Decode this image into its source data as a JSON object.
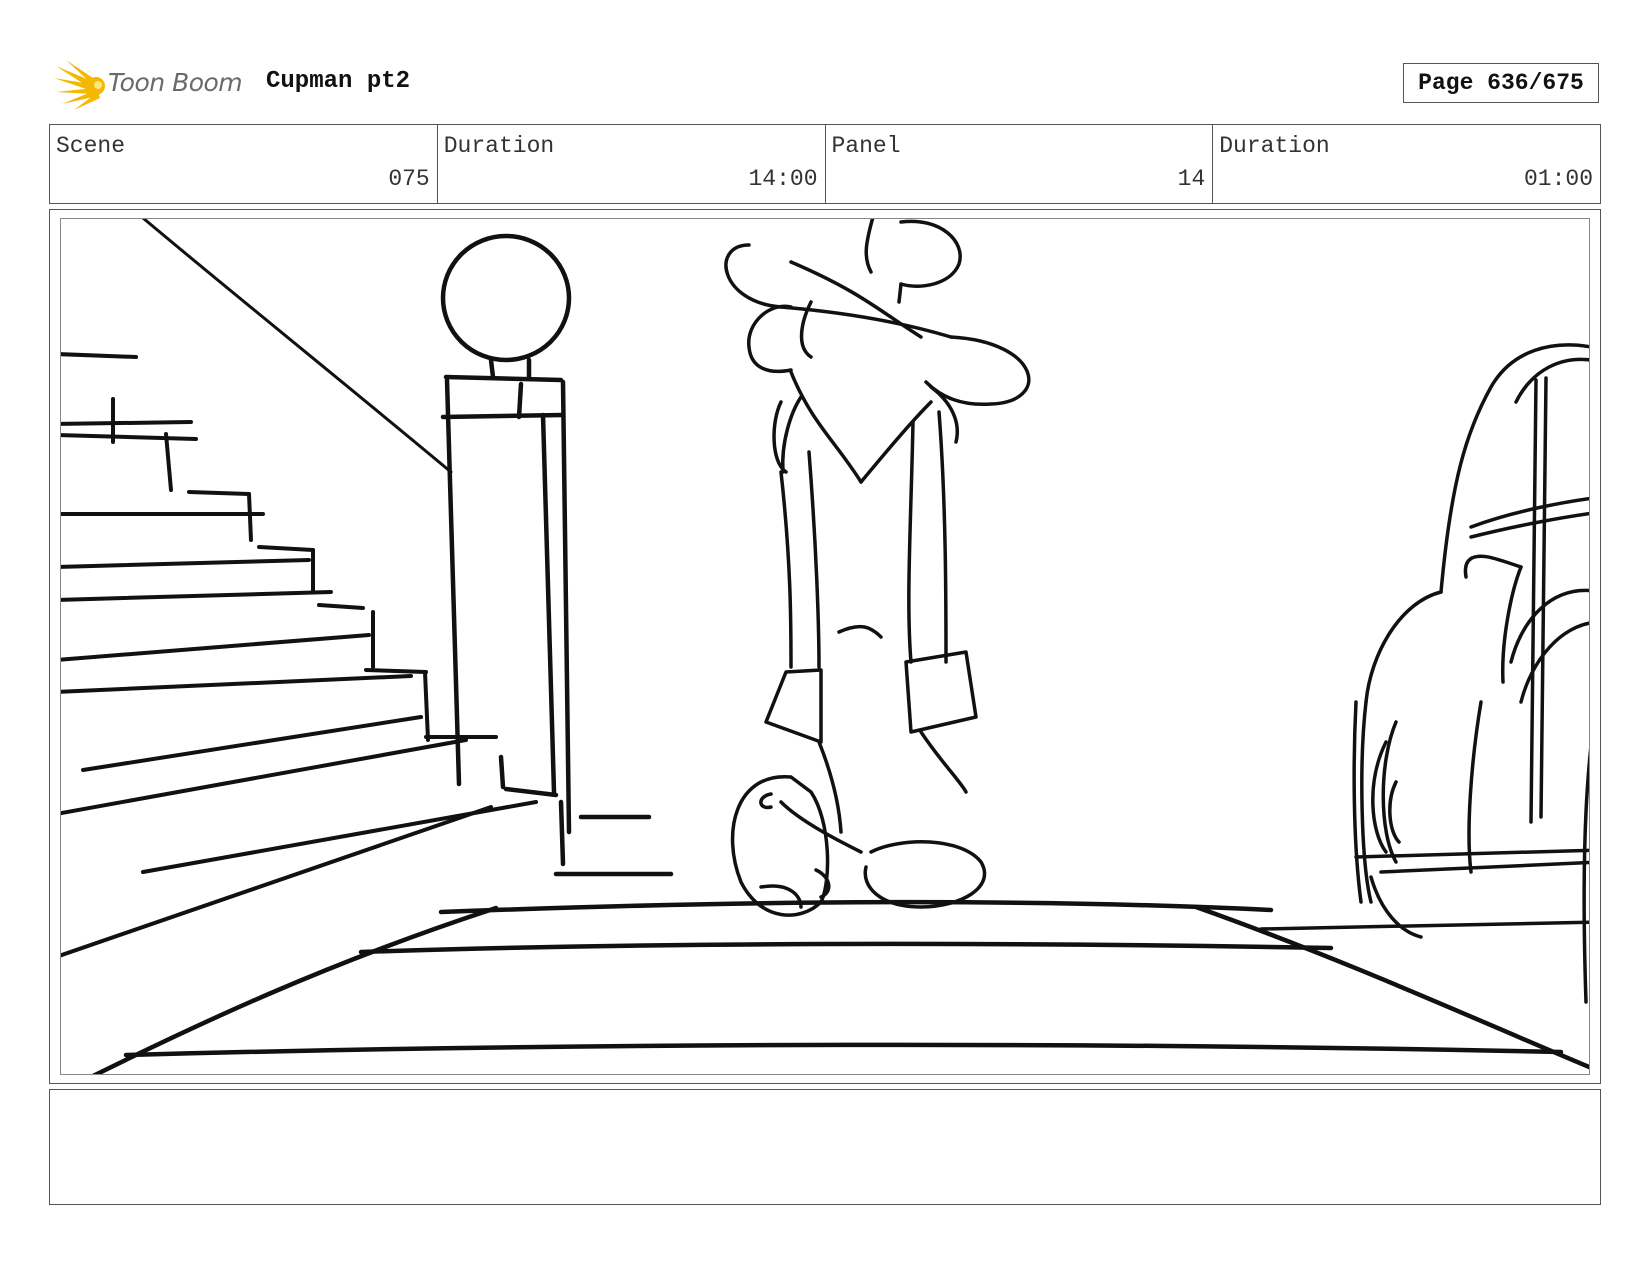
{
  "header": {
    "brand": "Toon Boom",
    "project_title": "Cupman pt2",
    "page_label": "Page 636/675"
  },
  "info": {
    "scene_label": "Scene",
    "scene_value": "075",
    "scene_duration_label": "Duration",
    "scene_duration_value": "14:00",
    "panel_label": "Panel",
    "panel_value": "14",
    "panel_duration_label": "Duration",
    "panel_duration_value": "01:00"
  },
  "notes": {
    "text": ""
  },
  "colors": {
    "logo_burst": "#f5b800",
    "brand_text": "#6a6a6a",
    "ink": "#111111"
  },
  "icons": {
    "logo": "sunburst-logo-icon"
  }
}
